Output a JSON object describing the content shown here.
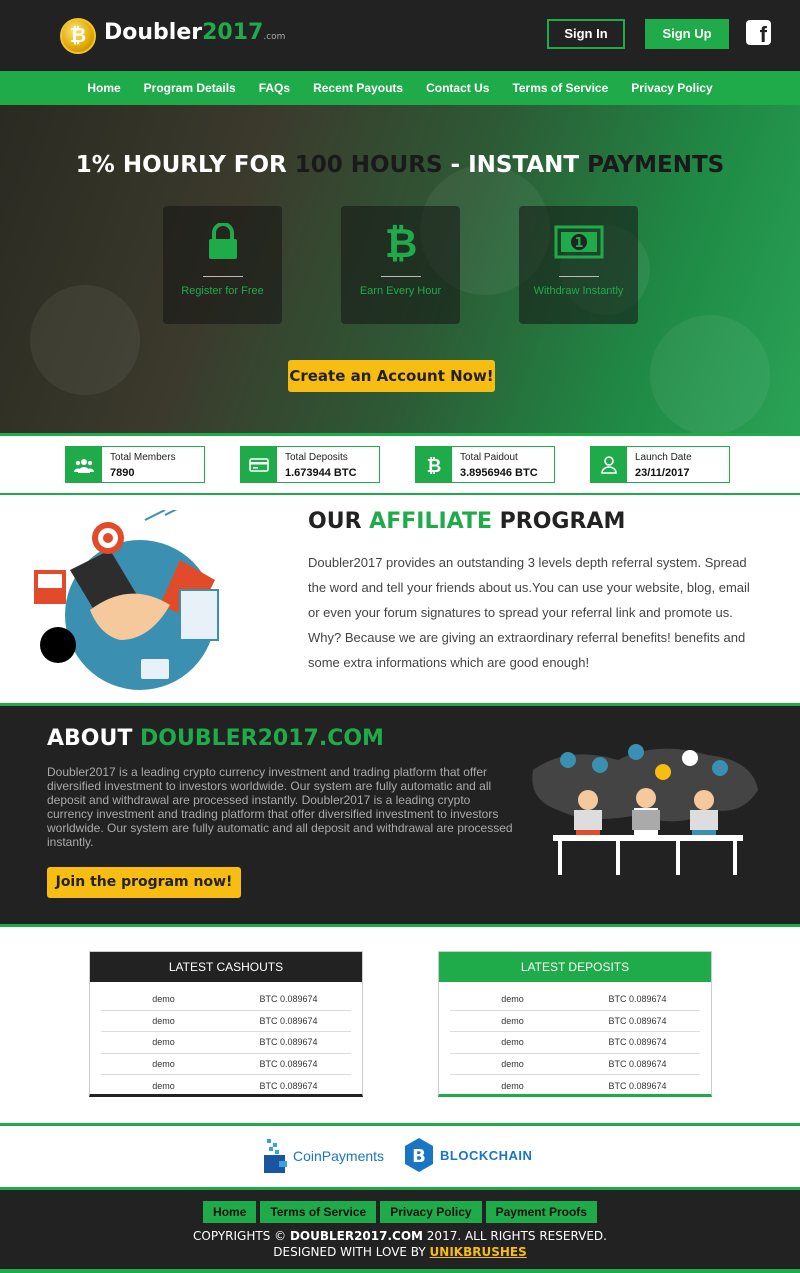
{
  "header": {
    "logo_name": "Doubler",
    "logo_year": "2017",
    "logo_suffix": ".com",
    "signin_label": "Sign In",
    "signup_label": "Sign Up",
    "facebook_icon": "facebook-icon"
  },
  "nav": {
    "items": [
      "Home",
      "Program Details",
      "FAQs",
      "Recent Payouts",
      "Contact Us",
      "Terms of Service",
      "Privacy Policy"
    ]
  },
  "hero": {
    "title_a": "1% HOURLY FOR ",
    "title_b": "100 HOURS",
    "title_c": " - INSTANT ",
    "title_d": "PAYMENTS",
    "features": [
      {
        "icon": "lock-icon",
        "label": "Register for Free"
      },
      {
        "icon": "bitcoin-icon",
        "label": "Earn Every Hour"
      },
      {
        "icon": "banknote-icon",
        "label": "Withdraw Instantly"
      }
    ],
    "cta_label": "Create an Account Now!"
  },
  "stats": [
    {
      "icon": "users-icon",
      "title": "Total Members",
      "value": "7890"
    },
    {
      "icon": "card-icon",
      "title": "Total Deposits",
      "value": "1.673944 BTC"
    },
    {
      "icon": "bitcoin-icon",
      "title": "Total Paidout",
      "value": "3.8956946 BTC"
    },
    {
      "icon": "user-icon",
      "title": "Launch Date",
      "value": "23/11/2017"
    }
  ],
  "affiliate": {
    "title_a": "OUR ",
    "title_b": "AFFILIATE",
    "title_c": " PROGRAM",
    "text": "Doubler2017 provides an outstanding 3 levels depth referral system. Spread the word and tell your friends about us.You can use your website, blog, email or even your forum signatures to spread your referral link and promote us. Why? Because we are giving an extraordinary referral benefits! benefits and some extra informations which are good enough!"
  },
  "about": {
    "title_a": "ABOUT ",
    "title_b": "DOUBLER2017.COM",
    "text": "Doubler2017 is a leading crypto currency investment and trading platform that offer diversified investment to investors worldwide. Our system are fully automatic and all deposit and withdrawal are processed instantly. Doubler2017 is a leading crypto currency investment and trading platform that offer diversified investment to investors worldwide. Our system are fully automatic and all deposit and withdrawal are processed instantly.",
    "join_label": "Join the program now!"
  },
  "cashouts": {
    "title": "LATEST CASHOUTS",
    "rows": [
      {
        "name": "demo",
        "amount": "BTC 0.089674"
      },
      {
        "name": "demo",
        "amount": "BTC 0.089674"
      },
      {
        "name": "demo",
        "amount": "BTC 0.089674"
      },
      {
        "name": "demo",
        "amount": "BTC 0.089674"
      },
      {
        "name": "demo",
        "amount": "BTC 0.089674"
      }
    ]
  },
  "deposits": {
    "title": "LATEST DEPOSITS",
    "rows": [
      {
        "name": "demo",
        "amount": "BTC 0.089674"
      },
      {
        "name": "demo",
        "amount": "BTC 0.089674"
      },
      {
        "name": "demo",
        "amount": "BTC 0.089674"
      },
      {
        "name": "demo",
        "amount": "BTC 0.089674"
      },
      {
        "name": "demo",
        "amount": "BTC 0.089674"
      }
    ]
  },
  "payments": {
    "coinpayments": "CoinPayments",
    "blockchain": "BLOCKCHAIN"
  },
  "footer": {
    "links": [
      "Home",
      "Terms of Service",
      "Privacy Policy",
      "Payment Proofs"
    ],
    "copy_a": "COPYRIGHTS © ",
    "copy_b": "DOUBLER2017.COM",
    "copy_c": " 2017. ALL RIGHTS RESERVED.",
    "designed_a": "DESIGNED WITH LOVE BY ",
    "designed_b": "UNIKBRUSHES"
  },
  "colors": {
    "brand_green": "#1fab4a",
    "dark": "#222222",
    "accent_yellow": "#f7bd12"
  }
}
